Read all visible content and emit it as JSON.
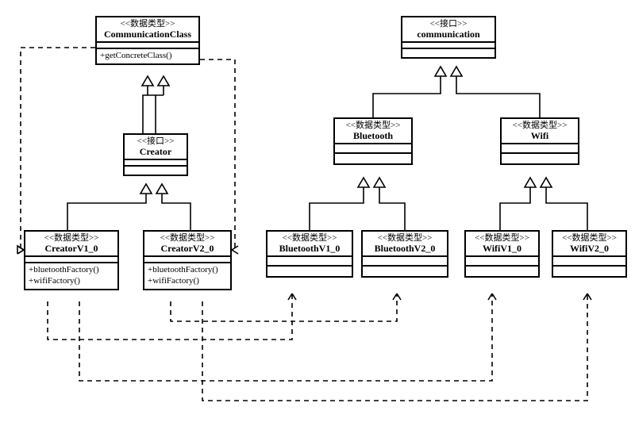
{
  "stereotypes": {
    "data": "<<数据类型>>",
    "iface": "<<接口>>"
  },
  "classes": {
    "commClass": {
      "name": "CommunicationClass",
      "op1": "+getConcreteClass()"
    },
    "creator": {
      "name": "Creator"
    },
    "creatorV1": {
      "name": "CreatorV1_0",
      "op1": "+bluetoothFactory()",
      "op2": "+wifiFactory()"
    },
    "creatorV2": {
      "name": "CreatorV2_0",
      "op1": "+bluetoothFactory()",
      "op2": "+wifiFactory()"
    },
    "communication": {
      "name": "communication"
    },
    "bluetooth": {
      "name": "Bluetooth"
    },
    "wifi": {
      "name": "Wifi"
    },
    "btV1": {
      "name": "BluetoothV1_0"
    },
    "btV2": {
      "name": "BluetoothV2_0"
    },
    "wifiV1": {
      "name": "WifiV1_0"
    },
    "wifiV2": {
      "name": "WifiV2_0"
    }
  },
  "chart_data": {
    "type": "uml-class-diagram",
    "nodes": [
      {
        "id": "CommunicationClass",
        "stereotype": "数据类型",
        "operations": [
          "+getConcreteClass()"
        ]
      },
      {
        "id": "Creator",
        "stereotype": "接口"
      },
      {
        "id": "CreatorV1_0",
        "stereotype": "数据类型",
        "operations": [
          "+bluetoothFactory()",
          "+wifiFactory()"
        ]
      },
      {
        "id": "CreatorV2_0",
        "stereotype": "数据类型",
        "operations": [
          "+bluetoothFactory()",
          "+wifiFactory()"
        ]
      },
      {
        "id": "communication",
        "stereotype": "接口"
      },
      {
        "id": "Bluetooth",
        "stereotype": "数据类型"
      },
      {
        "id": "Wifi",
        "stereotype": "数据类型"
      },
      {
        "id": "BluetoothV1_0",
        "stereotype": "数据类型"
      },
      {
        "id": "BluetoothV2_0",
        "stereotype": "数据类型"
      },
      {
        "id": "WifiV1_0",
        "stereotype": "数据类型"
      },
      {
        "id": "WifiV2_0",
        "stereotype": "数据类型"
      }
    ],
    "edges": [
      {
        "from": "Creator",
        "to": "CommunicationClass",
        "kind": "generalization"
      },
      {
        "from": "CreatorV1_0",
        "to": "Creator",
        "kind": "generalization"
      },
      {
        "from": "CreatorV2_0",
        "to": "Creator",
        "kind": "generalization"
      },
      {
        "from": "Bluetooth",
        "to": "communication",
        "kind": "generalization"
      },
      {
        "from": "Wifi",
        "to": "communication",
        "kind": "generalization"
      },
      {
        "from": "BluetoothV1_0",
        "to": "Bluetooth",
        "kind": "generalization"
      },
      {
        "from": "BluetoothV2_0",
        "to": "Bluetooth",
        "kind": "generalization"
      },
      {
        "from": "WifiV1_0",
        "to": "Wifi",
        "kind": "generalization"
      },
      {
        "from": "WifiV2_0",
        "to": "Wifi",
        "kind": "generalization"
      },
      {
        "from": "CommunicationClass",
        "to": "CreatorV1_0",
        "kind": "dependency"
      },
      {
        "from": "CommunicationClass",
        "to": "CreatorV2_0",
        "kind": "dependency"
      },
      {
        "from": "CreatorV1_0",
        "to": "BluetoothV1_0",
        "kind": "dependency"
      },
      {
        "from": "CreatorV1_0",
        "to": "WifiV1_0",
        "kind": "dependency"
      },
      {
        "from": "CreatorV2_0",
        "to": "BluetoothV2_0",
        "kind": "dependency"
      },
      {
        "from": "CreatorV2_0",
        "to": "WifiV2_0",
        "kind": "dependency"
      }
    ]
  }
}
